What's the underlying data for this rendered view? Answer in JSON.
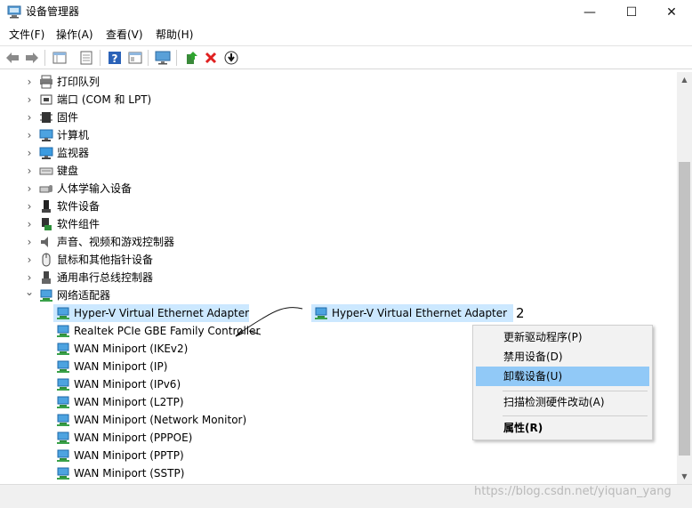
{
  "window": {
    "title": "设备管理器",
    "controls": {
      "minimize": "—",
      "maximize": "☐",
      "close": "✕"
    }
  },
  "menu": [
    "文件(F)",
    "操作(A)",
    "查看(V)",
    "帮助(H)"
  ],
  "toolbar": {
    "icons": [
      "back-arrow-icon",
      "forward-arrow-icon",
      "properties-grid-icon",
      "document-icon",
      "help-icon",
      "view-grid-icon",
      "monitor-icon",
      "update-driver-icon",
      "uninstall-x-icon",
      "download-circle-icon"
    ]
  },
  "tree": {
    "categories": [
      {
        "label": "打印队列",
        "icon": "printer-icon"
      },
      {
        "label": "端口 (COM 和 LPT)",
        "icon": "port-icon"
      },
      {
        "label": "固件",
        "icon": "firmware-chip-icon"
      },
      {
        "label": "计算机",
        "icon": "computer-icon"
      },
      {
        "label": "监视器",
        "icon": "monitor-icon"
      },
      {
        "label": "键盘",
        "icon": "keyboard-icon"
      },
      {
        "label": "人体学输入设备",
        "icon": "hid-icon"
      },
      {
        "label": "软件设备",
        "icon": "software-device-icon"
      },
      {
        "label": "软件组件",
        "icon": "software-component-icon"
      },
      {
        "label": "声音、视频和游戏控制器",
        "icon": "speaker-icon"
      },
      {
        "label": "鼠标和其他指针设备",
        "icon": "mouse-icon"
      },
      {
        "label": "通用串行总线控制器",
        "icon": "usb-icon"
      },
      {
        "label": "网络适配器",
        "icon": "network-adapter-icon",
        "expanded": true
      }
    ],
    "adapters": [
      "Hyper-V Virtual Ethernet Adapter",
      "Realtek PCIe GBE Family Controller",
      "WAN Miniport (IKEv2)",
      "WAN Miniport (IP)",
      "WAN Miniport (IPv6)",
      "WAN Miniport (L2TP)",
      "WAN Miniport (Network Monitor)",
      "WAN Miniport (PPPOE)",
      "WAN Miniport (PPTP)",
      "WAN Miniport (SSTP)"
    ]
  },
  "annotation": {
    "copied_label": "Hyper-V Virtual Ethernet Adapter",
    "number": "2"
  },
  "context_menu": {
    "items": [
      "更新驱动程序(P)",
      "禁用设备(D)",
      "卸载设备(U)",
      "扫描检测硬件改动(A)",
      "属性(R)"
    ],
    "highlighted": "卸载设备(U)"
  },
  "watermark": "https://blog.csdn.net/yiquan_yang",
  "colors": {
    "selection": "#cce8ff",
    "menu_highlight": "#91c9f7",
    "uninstall_red": "#e02020"
  }
}
